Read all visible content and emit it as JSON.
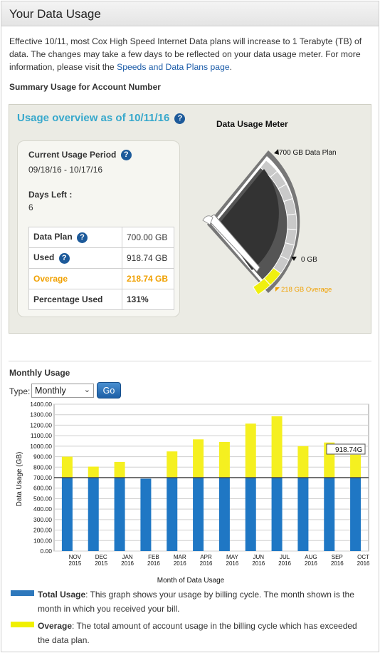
{
  "header": {
    "title": "Your Data Usage"
  },
  "intro": {
    "text": "Effective 10/11, most Cox High Speed Internet Data plans will increase to 1 Terabyte (TB) of data. The changes may take a few days to be reflected on your data usage meter. For more information, please visit the ",
    "link": "Speeds and Data Plans page",
    "end": "."
  },
  "summary_title": "Summary Usage for Account Number",
  "overview": {
    "title": "Usage overview as of 10/11/16",
    "help_glyph": "?",
    "period_label": "Current Usage Period",
    "period_value": "09/18/16 - 10/17/16",
    "days_left_label": "Days Left :",
    "days_left_value": "6",
    "rows": [
      {
        "label": "Data Plan",
        "value": "700.00 GB",
        "help": true
      },
      {
        "label": "Used",
        "value": "918.74 GB",
        "help": true
      },
      {
        "label": "Overage",
        "value": "218.74 GB",
        "help": false
      },
      {
        "label": "Percentage Used",
        "value": "131%",
        "help": false
      }
    ]
  },
  "meter": {
    "title": "Data Usage Meter",
    "plan_label": "700 GB Data Plan",
    "zero_label": "0 GB",
    "overage_label": "218 GB Overage",
    "usage_fraction": 1.31,
    "overage_color": "#f0a000"
  },
  "monthly": {
    "title": "Monthly Usage",
    "type_label": "Type:",
    "type_value": "Monthly",
    "go_label": "Go"
  },
  "chart_data": {
    "type": "bar",
    "stacked": true,
    "categories": [
      "NOV 2015",
      "DEC 2015",
      "JAN 2016",
      "FEB 2016",
      "MAR 2016",
      "APR 2016",
      "MAY 2016",
      "JUN 2016",
      "JUL 2016",
      "AUG 2016",
      "SEP 2016",
      "OCT 2016"
    ],
    "series": [
      {
        "name": "Total Usage",
        "color": "#1f77c4",
        "values": [
          700,
          700,
          700,
          690,
          700,
          700,
          700,
          700,
          700,
          700,
          700,
          700
        ]
      },
      {
        "name": "Overage",
        "color": "#f5f020",
        "values": [
          200,
          105,
          150,
          0,
          250,
          365,
          340,
          515,
          585,
          300,
          335,
          218.74
        ]
      }
    ],
    "plan_line": 700,
    "tooltip": "918.74G",
    "yticks": [
      "0.00",
      "100.00",
      "200.00",
      "300.00",
      "400.00",
      "500.00",
      "600.00",
      "700.00",
      "800.00",
      "900.00",
      "1000.00",
      "1100.00",
      "1200.00",
      "1300.00",
      "1400.00"
    ],
    "ylim": [
      0,
      1400
    ],
    "ylabel": "Data Usage (GB)",
    "xlabel": "Month of Data Usage",
    "grid": true
  },
  "legend": [
    {
      "name": "Total Usage",
      "desc": ": This graph shows your usage by billing cycle. The month shown is the month in which you received your bill.",
      "color": "#1f77c4"
    },
    {
      "name": "Overage",
      "desc": ": The total amount of account usage in the billing cycle which has exceeded the data plan.",
      "color": "#f0f000"
    }
  ]
}
